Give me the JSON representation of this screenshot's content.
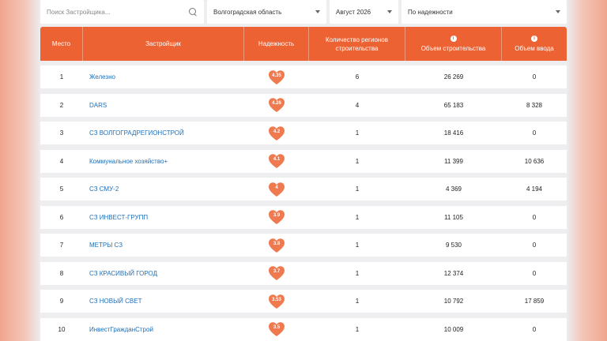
{
  "filters": {
    "search_placeholder": "Поиск Застройщика...",
    "region": "Волгоградская область",
    "month": "Август 2026",
    "sort": "По надежности"
  },
  "columns": {
    "place": "Место",
    "developer": "Застройщик",
    "reliability": "Надежность",
    "regions": "Количество регионов строительства",
    "construction": "Объем строительства",
    "commissioning": "Объем ввода"
  },
  "colors": {
    "accent": "#ec6233",
    "heart": "#f07a4f",
    "link": "#1f6fb8"
  },
  "rows": [
    {
      "place": "1",
      "name": "Железно",
      "rating": "4.35",
      "regions": "6",
      "construction": "26 269",
      "commissioning": "0"
    },
    {
      "place": "2",
      "name": "DARS",
      "rating": "4.26",
      "regions": "4",
      "construction": "65 183",
      "commissioning": "8 328"
    },
    {
      "place": "3",
      "name": "СЗ ВОЛГОГРАДРЕГИОНСТРОЙ",
      "rating": "4.2",
      "regions": "1",
      "construction": "18 416",
      "commissioning": "0"
    },
    {
      "place": "4",
      "name": "Коммунальное хозяйство+",
      "rating": "4.1",
      "regions": "1",
      "construction": "11 399",
      "commissioning": "10 636"
    },
    {
      "place": "5",
      "name": "СЗ СМУ-2",
      "rating": "4",
      "regions": "1",
      "construction": "4 369",
      "commissioning": "4 194"
    },
    {
      "place": "6",
      "name": "СЗ ИНВЕСТ-ГРУПП",
      "rating": "3.9",
      "regions": "1",
      "construction": "11 105",
      "commissioning": "0"
    },
    {
      "place": "7",
      "name": "МЕТРЫ СЗ",
      "rating": "3.8",
      "regions": "1",
      "construction": "9 530",
      "commissioning": "0"
    },
    {
      "place": "8",
      "name": "СЗ КРАСИВЫЙ ГОРОД",
      "rating": "3.7",
      "regions": "1",
      "construction": "12 374",
      "commissioning": "0"
    },
    {
      "place": "9",
      "name": "СЗ НОВЫЙ СВЕТ",
      "rating": "3.53",
      "regions": "1",
      "construction": "10 792",
      "commissioning": "17 859"
    },
    {
      "place": "10",
      "name": "ИнвестГражданСтрой",
      "rating": "3.5",
      "regions": "1",
      "construction": "10 009",
      "commissioning": "0"
    }
  ]
}
